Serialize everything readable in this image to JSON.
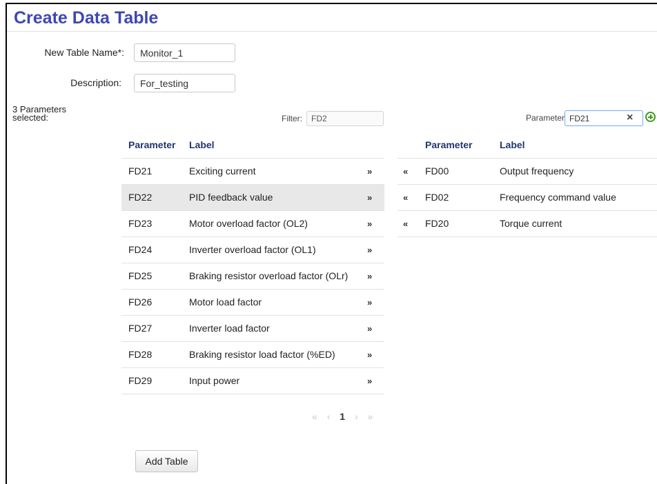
{
  "page": {
    "title": "Create Data Table"
  },
  "form": {
    "table_name_label": "New Table Name*:",
    "table_name_value": "Monitor_1",
    "description_label": "Description:",
    "description_value": "For_testing",
    "selected_count": "3 Parameters selected:"
  },
  "available": {
    "filter_label": "Filter:",
    "filter_value": "FD2",
    "headers": {
      "parameter": "Parameter",
      "label": "Label"
    },
    "rows": [
      {
        "parameter": "FD21",
        "label": "Exciting current",
        "action": "»"
      },
      {
        "parameter": "FD22",
        "label": "PID feedback value",
        "action": "»",
        "highlighted": true
      },
      {
        "parameter": "FD23",
        "label": "Motor overload factor (OL2)",
        "action": "»"
      },
      {
        "parameter": "FD24",
        "label": "Inverter overload factor (OL1)",
        "action": "»"
      },
      {
        "parameter": "FD25",
        "label": "Braking resistor overload factor (OLr)",
        "action": "»"
      },
      {
        "parameter": "FD26",
        "label": "Motor load factor",
        "action": "»"
      },
      {
        "parameter": "FD27",
        "label": "Inverter load factor",
        "action": "»"
      },
      {
        "parameter": "FD28",
        "label": "Braking resistor load factor (%ED)",
        "action": "»"
      },
      {
        "parameter": "FD29",
        "label": "Input power",
        "action": "»"
      }
    ],
    "pagination": {
      "first": "«",
      "prev": "‹",
      "current": "1",
      "next": "›",
      "last": "»"
    }
  },
  "selected": {
    "search_label": "Parameter",
    "search_value": "FD21",
    "clear_symbol": "×",
    "headers": {
      "parameter": "Parameter",
      "label": "Label"
    },
    "rows": [
      {
        "action": "«",
        "parameter": "FD00",
        "label": "Output frequency"
      },
      {
        "action": "«",
        "parameter": "FD02",
        "label": "Frequency command value"
      },
      {
        "action": "«",
        "parameter": "FD20",
        "label": "Torque current"
      }
    ]
  },
  "buttons": {
    "add_table": "Add Table"
  },
  "icons": {
    "clear": "close-icon",
    "add": "plus-circle-icon"
  },
  "colors": {
    "title": "#3d47b5",
    "header_text": "#22356b",
    "add_icon": "#3a9a1a",
    "row_highlight": "#e8e8e8"
  }
}
